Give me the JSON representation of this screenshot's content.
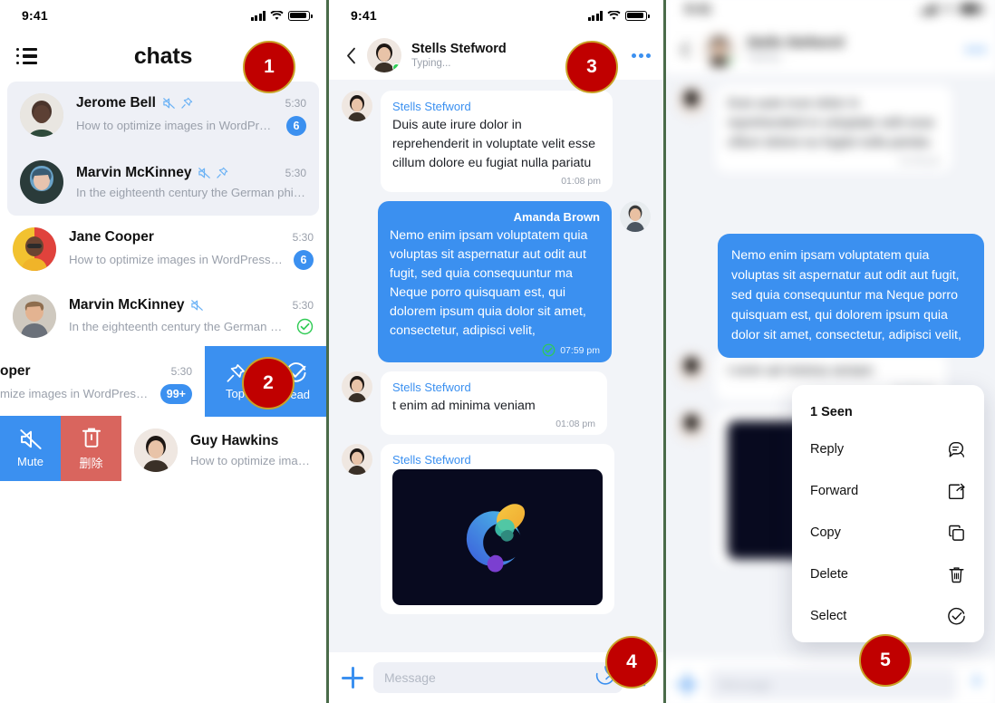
{
  "status_bar": {
    "time": "9:41"
  },
  "left_panel": {
    "header": {
      "title": "chats",
      "menu_icon": "list-bullets-icon"
    },
    "chats": [
      {
        "name": "Jerome Bell",
        "preview": "How to optimize images in WordPress for...",
        "time": "5:30",
        "badge": "6",
        "muted": true,
        "pinned": true,
        "selected": true,
        "read_check": false
      },
      {
        "name": "Marvin McKinney",
        "preview": "In the eighteenth century the German philosoph...",
        "time": "5:30",
        "badge": "",
        "muted": true,
        "pinned": true,
        "selected": true,
        "read_check": false
      },
      {
        "name": "Jane Cooper",
        "preview": "How to optimize images in WordPress for...",
        "time": "5:30",
        "badge": "6",
        "muted": false,
        "pinned": false,
        "selected": false,
        "read_check": false
      },
      {
        "name": "Marvin McKinney",
        "preview": "In the eighteenth century the German philos...",
        "time": "5:30",
        "badge": "",
        "muted": true,
        "pinned": false,
        "selected": false,
        "read_check": true
      },
      {
        "name": "oper",
        "preview": "mize images in WordPress...",
        "time": "5:30",
        "badge": "99+",
        "muted": false,
        "pinned": false,
        "selected": false,
        "read_check": false
      },
      {
        "name": "Guy Hawkins",
        "preview": "How to optimize images in W",
        "time": "",
        "badge": "",
        "muted": false,
        "pinned": false,
        "selected": false,
        "read_check": false
      }
    ],
    "swipe_right_actions": [
      {
        "label": "Top",
        "icon": "pin-icon"
      },
      {
        "label": "Read",
        "icon": "check-circle-icon"
      }
    ],
    "swipe_left_actions": [
      {
        "label": "Mute",
        "icon": "mute-bell-icon"
      },
      {
        "label": "删除",
        "icon": "trash-icon"
      }
    ]
  },
  "mid_panel": {
    "header": {
      "back_icon": "chevron-left-icon",
      "name": "Stells Stefword",
      "status": "Typing...",
      "more_icon": "more-dots-icon"
    },
    "messages": [
      {
        "side": "them",
        "sender": "Stells Stefword",
        "text": "Duis aute irure dolor in reprehenderit in voluptate velit esse cillum dolore eu fugiat nulla pariatu",
        "time": "01:08 pm",
        "delivered": false,
        "type": "text"
      },
      {
        "side": "me",
        "sender": "Amanda Brown",
        "text": "Nemo enim ipsam voluptatem quia voluptas sit aspernatur aut odit aut fugit, sed quia consequuntur ma Neque porro quisquam est, qui dolorem ipsum quia dolor sit amet, consectetur, adipisci velit,",
        "time": "07:59 pm",
        "delivered": true,
        "type": "text"
      },
      {
        "side": "them",
        "sender": "Stells Stefword",
        "text": "t enim ad minima veniam",
        "time": "01:08 pm",
        "delivered": false,
        "type": "text"
      },
      {
        "side": "them",
        "sender": "Stells Stefword",
        "text": "",
        "time": "",
        "delivered": false,
        "type": "image"
      }
    ],
    "composer": {
      "plus_icon": "plus-icon",
      "placeholder": "Message",
      "sticker_icon": "sticker-icon",
      "mic_icon": "microphone-icon"
    }
  },
  "right_panel": {
    "highlight_message": "Nemo enim ipsam voluptatem quia voluptas sit aspernatur aut odit aut fugit, sed quia consequuntur ma Neque porro quisquam est, qui dolorem ipsum quia dolor sit amet, consectetur, adipisci velit,",
    "context_menu": {
      "header": "1 Seen",
      "items": [
        {
          "label": "Reply",
          "icon": "reply-bubble-icon"
        },
        {
          "label": "Forward",
          "icon": "forward-share-icon"
        },
        {
          "label": "Copy",
          "icon": "copy-icon"
        },
        {
          "label": "Delete",
          "icon": "trash-icon"
        },
        {
          "label": "Select",
          "icon": "check-circle-icon"
        }
      ]
    }
  },
  "steps": [
    {
      "n": "1"
    },
    {
      "n": "2"
    },
    {
      "n": "3"
    },
    {
      "n": "4"
    },
    {
      "n": "5"
    }
  ],
  "colors": {
    "accent_blue": "#3b90f0",
    "delete_red": "#d9655e",
    "marker_red": "#c00000",
    "marker_gold": "#c9a227",
    "green_check": "#2fcb54",
    "bg_chat": "#f2f4f8"
  }
}
